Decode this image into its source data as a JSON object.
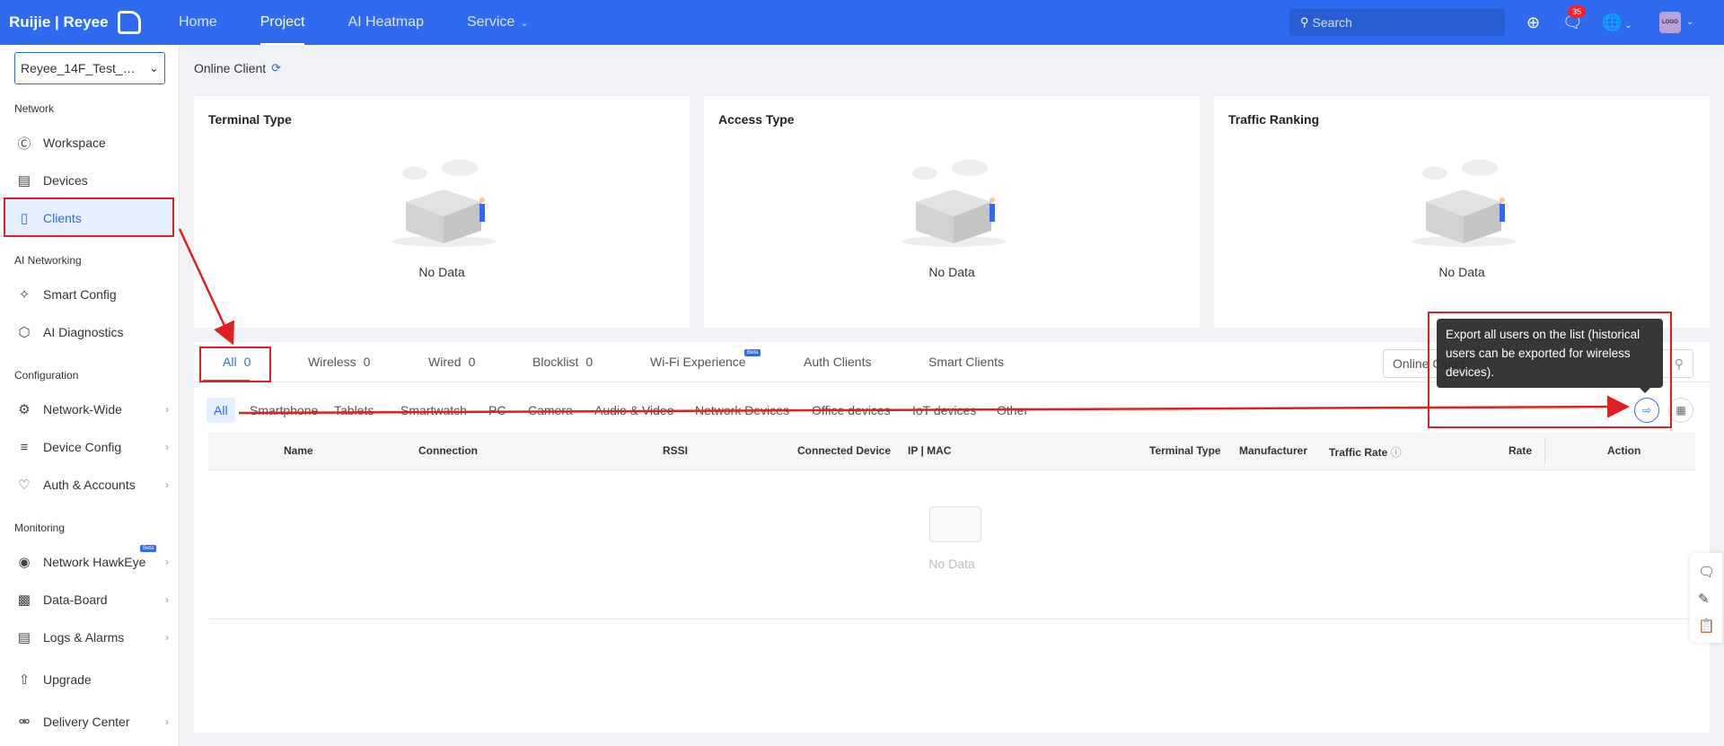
{
  "topbar": {
    "logo_text": "Ruijie | Reyee",
    "nav": [
      {
        "label": "Home"
      },
      {
        "label": "Project"
      },
      {
        "label": "AI Heatmap"
      },
      {
        "label": "Service"
      }
    ],
    "search_placeholder": "Search",
    "notification_count": "35",
    "avatar_text": "LOGO"
  },
  "sidebar": {
    "project_name": "Reyee_14F_Test_E...",
    "sections": {
      "network": "Network",
      "ai_networking": "AI Networking",
      "configuration": "Configuration",
      "monitoring": "Monitoring"
    },
    "items": [
      {
        "label": "Workspace",
        "icon": "workspace-icon"
      },
      {
        "label": "Devices",
        "icon": "devices-icon"
      },
      {
        "label": "Clients",
        "icon": "clients-icon"
      },
      {
        "label": "Smart Config",
        "icon": "smart-config-icon"
      },
      {
        "label": "AI Diagnostics",
        "icon": "ai-diagnostics-icon"
      },
      {
        "label": "Network-Wide",
        "icon": "gear-icon"
      },
      {
        "label": "Device Config",
        "icon": "sliders-icon"
      },
      {
        "label": "Auth & Accounts",
        "icon": "shield-icon"
      },
      {
        "label": "Network HawkEye",
        "icon": "eye-icon"
      },
      {
        "label": "Data-Board",
        "icon": "chart-icon"
      },
      {
        "label": "Logs & Alarms",
        "icon": "logs-icon"
      },
      {
        "label": "Upgrade",
        "icon": "upgrade-icon"
      },
      {
        "label": "Delivery Center",
        "icon": "delivery-icon"
      }
    ],
    "beta_label": "Beta"
  },
  "main": {
    "breadcrumb": "Online Client",
    "cards": [
      {
        "title": "Terminal Type",
        "empty": "No Data"
      },
      {
        "title": "Access Type",
        "empty": "No Data"
      },
      {
        "title": "Traffic Ranking",
        "empty": "No Data"
      }
    ],
    "tabs": [
      {
        "label": "All",
        "count": "0"
      },
      {
        "label": "Wireless",
        "count": "0"
      },
      {
        "label": "Wired",
        "count": "0"
      },
      {
        "label": "Blocklist",
        "count": "0"
      },
      {
        "label": "Wi-Fi Experience",
        "count": ""
      },
      {
        "label": "Auth Clients",
        "count": ""
      },
      {
        "label": "Smart Clients",
        "count": ""
      }
    ],
    "wifi_beta": "Beta",
    "filter_value": "Online Client",
    "chips": [
      "All",
      "Smartphone",
      "Tablets",
      "Smartwatch",
      "PC",
      "Camera",
      "Audio & Video",
      "Network Devices",
      "Office devices",
      "IoT devices",
      "Other"
    ],
    "columns": [
      "Name",
      "Connection",
      "RSSI",
      "Connected Device",
      "IP | MAC",
      "Terminal Type",
      "Manufacturer",
      "Traffic Rate",
      "Rate",
      "Action"
    ],
    "table_empty": "No Data",
    "tooltip": "Export all users on the list (historical users can be exported for wireless devices)."
  },
  "colors": {
    "brand": "#2f6bf0",
    "annotation": "#e02020"
  }
}
